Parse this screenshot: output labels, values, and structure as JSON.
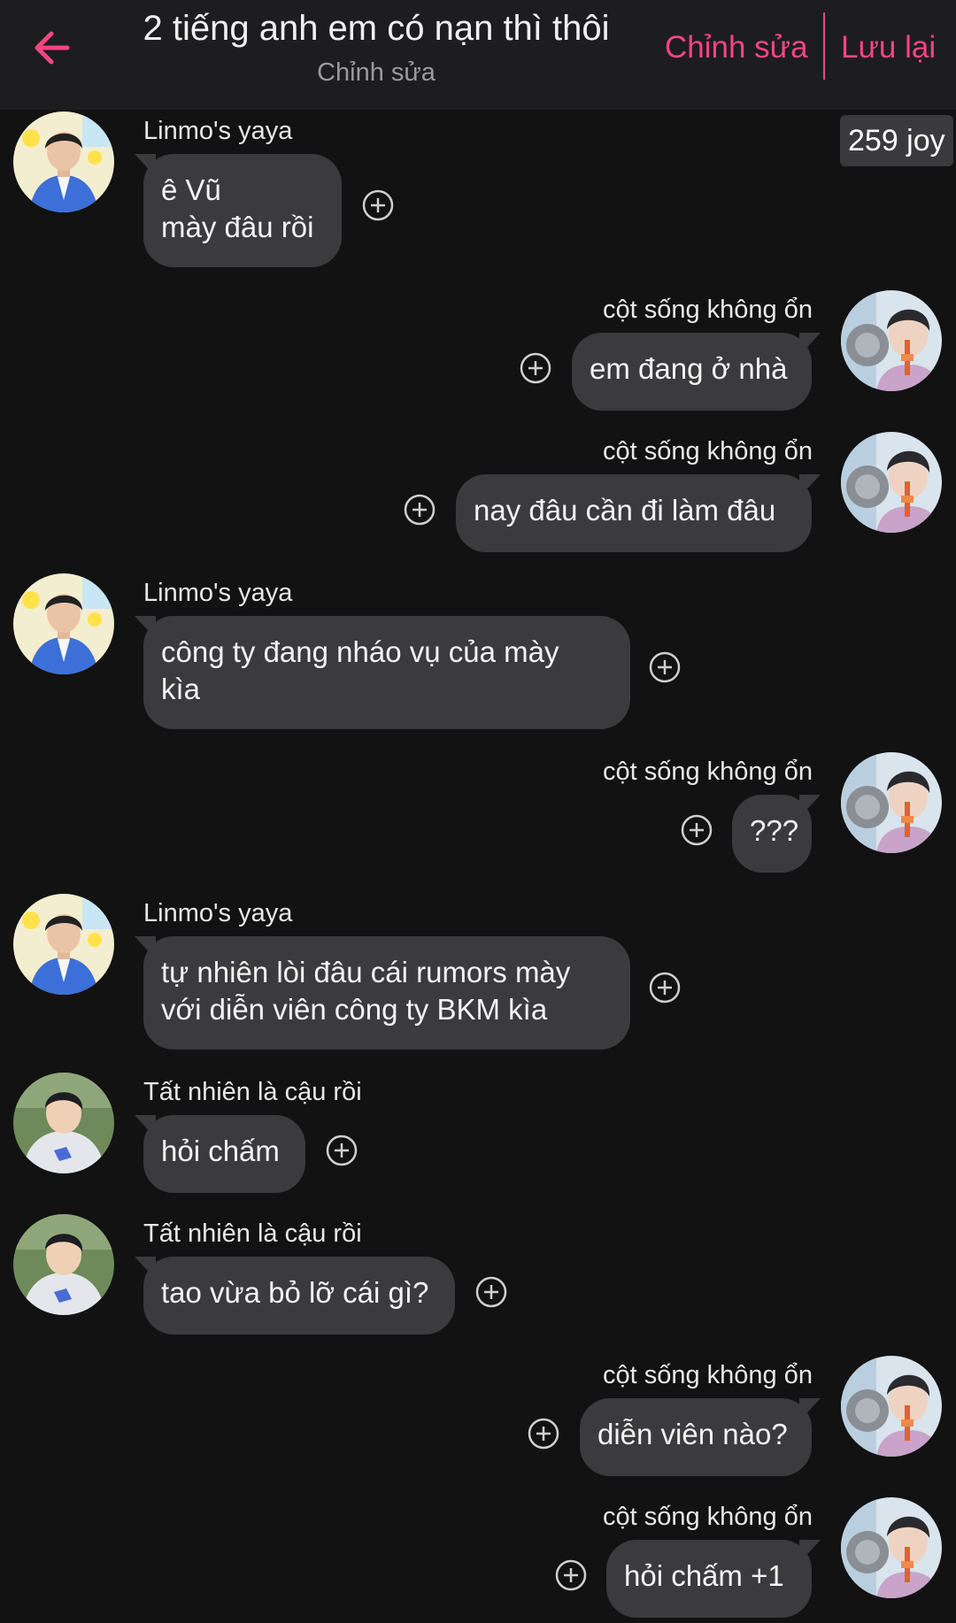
{
  "header": {
    "title": "2 tiếng anh em có nạn thì thôi",
    "subtitle": "Chỉnh sửa",
    "edit_label": "Chỉnh sửa",
    "save_label": "Lưu lại",
    "back_icon": "arrow-left-icon",
    "accent_color": "#f2467f"
  },
  "joy_badge": "259 joy",
  "colors": {
    "background": "#121213",
    "header": "#1d1d1f",
    "bubble": "#3b3b3d",
    "accent": "#f2467f"
  },
  "messages": [
    {
      "sender": "Linmo's yaya",
      "side": "left",
      "avatar": "blue-jacket-man",
      "lines": [
        "ê Vũ",
        "mày đâu rồi"
      ]
    },
    {
      "sender": "cột sống không ổn",
      "side": "right",
      "avatar": "boy-with-straw",
      "lines": [
        "em đang ở nhà"
      ]
    },
    {
      "sender": "cột sống không ổn",
      "side": "right",
      "avatar": "boy-with-straw",
      "lines": [
        "nay đâu cần đi làm đâu"
      ]
    },
    {
      "sender": "Linmo's yaya",
      "side": "left",
      "avatar": "blue-jacket-man",
      "lines": [
        "công ty đang nháo vụ của mày",
        "kìa"
      ]
    },
    {
      "sender": "cột sống không ổn",
      "side": "right",
      "avatar": "boy-with-straw",
      "lines": [
        "???"
      ]
    },
    {
      "sender": "Linmo's yaya",
      "side": "left",
      "avatar": "blue-jacket-man",
      "lines": [
        "tự nhiên lòi đâu cái rumors mày",
        "với diễn viên công ty BKM kìa"
      ]
    },
    {
      "sender": "Tất nhiên là cậu rồi",
      "side": "left",
      "avatar": "hoodie-boy",
      "lines": [
        "hỏi chấm"
      ]
    },
    {
      "sender": "Tất nhiên là cậu rồi",
      "side": "left",
      "avatar": "hoodie-boy",
      "lines": [
        "tao vừa bỏ lỡ cái gì?"
      ]
    },
    {
      "sender": "cột sống không ổn",
      "side": "right",
      "avatar": "boy-with-straw",
      "lines": [
        "diễn viên nào?"
      ]
    },
    {
      "sender": "cột sống không ổn",
      "side": "right",
      "avatar": "boy-with-straw",
      "lines": [
        "hỏi chấm +1"
      ]
    }
  ]
}
